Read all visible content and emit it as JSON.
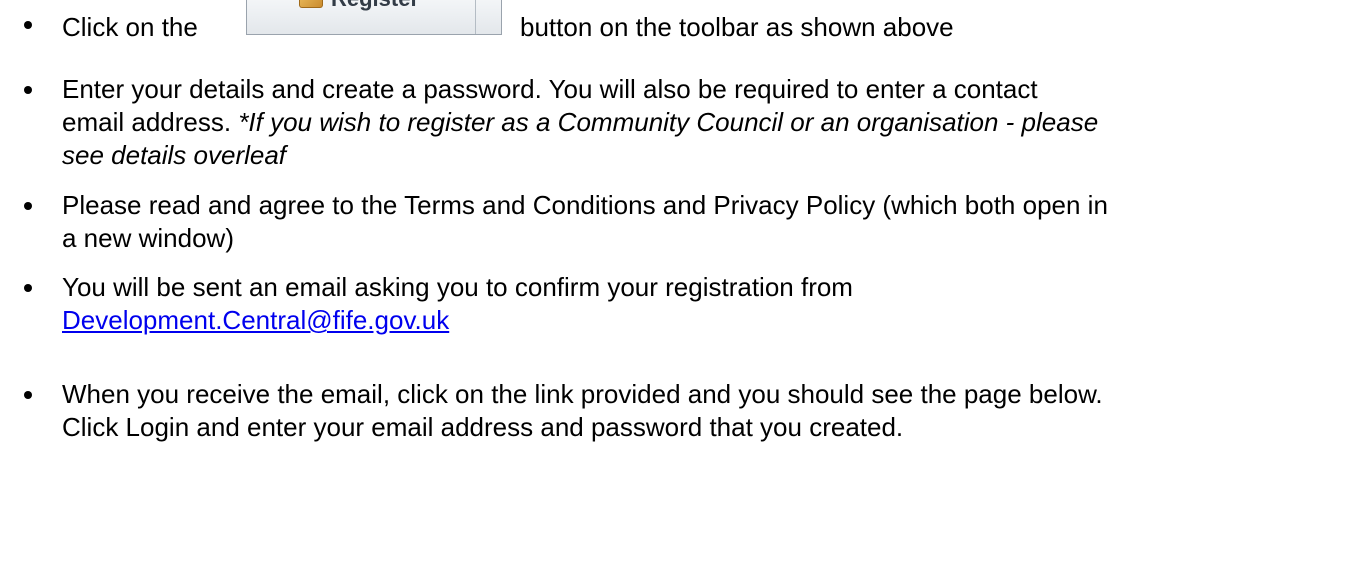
{
  "toolbar_button": {
    "label": "Register",
    "icon": "register-icon"
  },
  "items": [
    {
      "before": "Click on the",
      "after": "button on the toolbar as shown above"
    },
    {
      "line1": "Enter your details and create a password.  You will also be required to enter a contact",
      "line2_plain": "email address.  ",
      "line2_italic": "*If you wish to register as a Community Council or an organisation - please",
      "line3_italic": "see details overleaf"
    },
    {
      "line1": "Please read and agree to the Terms and Conditions and Privacy Policy (which both open in",
      "line2": "a new window)"
    },
    {
      "line1": "You will be sent an email asking you to confirm your registration from",
      "link": "Development.Central@fife.gov.uk"
    },
    {
      "line1": "When you receive the email, click on the link provided and you should see the page below.",
      "line2": "Click Login and enter your email address and password that you created."
    }
  ]
}
